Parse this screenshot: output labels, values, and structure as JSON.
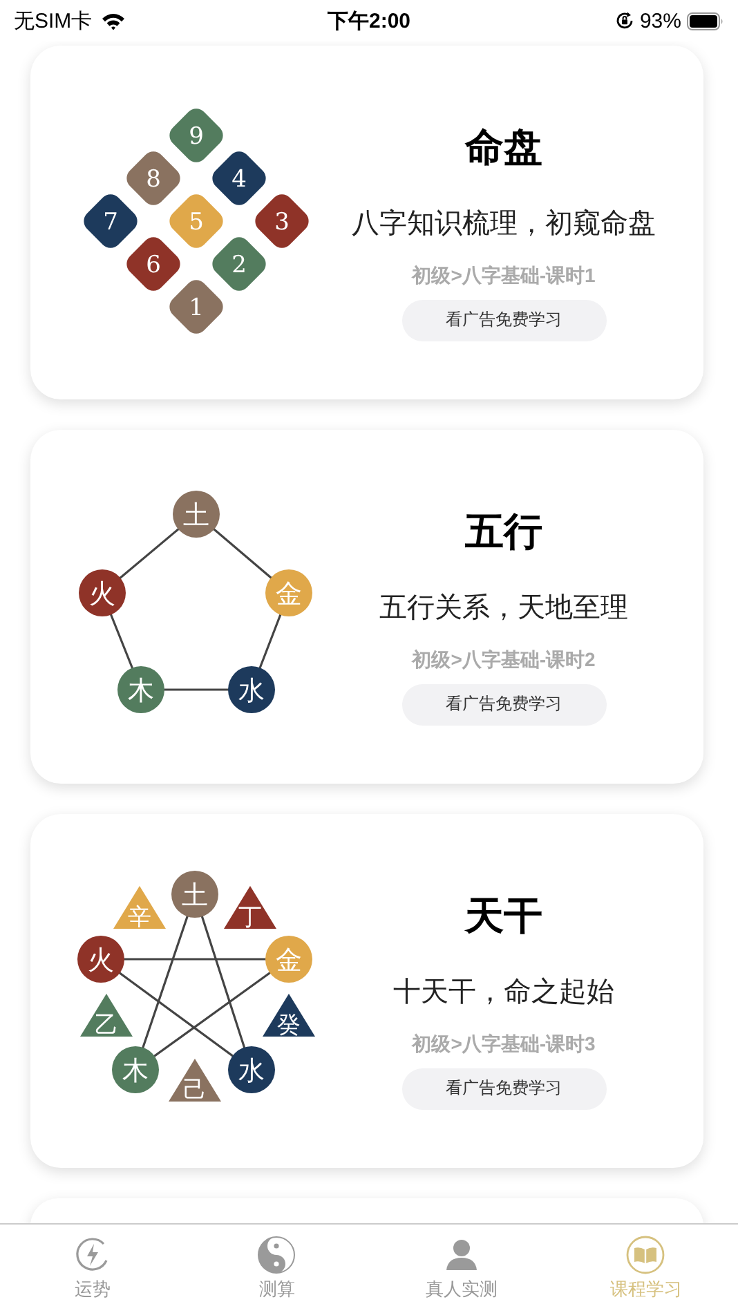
{
  "status_bar": {
    "carrier": "无SIM卡",
    "time": "下午2:00",
    "battery": "93%"
  },
  "lessons": [
    {
      "title": "命盘",
      "subtitle": "八字知识梳理，初窥命盘",
      "path": "初级>八字基础-课时1",
      "button": "看广告免费学习",
      "diagram": {
        "kind": "grid",
        "nodes": [
          {
            "label": "9",
            "kind": "diamond",
            "color": "#537c5e"
          },
          {
            "label": "8",
            "kind": "diamond",
            "color": "#8a7260"
          },
          {
            "label": "4",
            "kind": "diamond",
            "color": "#1d3a5c"
          },
          {
            "label": "7",
            "kind": "diamond",
            "color": "#1d3a5c"
          },
          {
            "label": "5",
            "kind": "diamond",
            "color": "#e0a84a"
          },
          {
            "label": "3",
            "kind": "diamond",
            "color": "#8f3328"
          },
          {
            "label": "6",
            "kind": "diamond",
            "color": "#8f3328"
          },
          {
            "label": "2",
            "kind": "diamond",
            "color": "#537c5e"
          },
          {
            "label": "1",
            "kind": "diamond",
            "color": "#8a7260"
          }
        ]
      }
    },
    {
      "title": "五行",
      "subtitle": "五行关系，天地至理",
      "path": "初级>八字基础-课时2",
      "button": "看广告免费学习",
      "diagram": {
        "kind": "pentagon",
        "nodes": [
          {
            "label": "土",
            "kind": "circle",
            "color": "#8a7260"
          },
          {
            "label": "火",
            "kind": "circle",
            "color": "#8f3328"
          },
          {
            "label": "金",
            "kind": "circle",
            "color": "#e0a84a"
          },
          {
            "label": "木",
            "kind": "circle",
            "color": "#537c5e"
          },
          {
            "label": "水",
            "kind": "circle",
            "color": "#1d3a5c"
          }
        ]
      }
    },
    {
      "title": "天干",
      "subtitle": "十天干，命之起始",
      "path": "初级>八字基础-课时3",
      "button": "看广告免费学习",
      "diagram": {
        "kind": "star",
        "nodes": [
          {
            "label": "辛",
            "kind": "triangle",
            "color": "#e0a84a"
          },
          {
            "label": "土",
            "kind": "circle",
            "color": "#8a7260"
          },
          {
            "label": "丁",
            "kind": "triangle",
            "color": "#8f3328"
          },
          {
            "label": "火",
            "kind": "circle",
            "color": "#8f3328"
          },
          {
            "label": "金",
            "kind": "circle",
            "color": "#e0a84a"
          },
          {
            "label": "乙",
            "kind": "triangle",
            "color": "#537c5e"
          },
          {
            "label": "癸",
            "kind": "triangle",
            "color": "#1d3a5c"
          },
          {
            "label": "木",
            "kind": "circle",
            "color": "#537c5e"
          },
          {
            "label": "己",
            "kind": "triangle",
            "color": "#8a7260"
          },
          {
            "label": "水",
            "kind": "circle",
            "color": "#1d3a5c"
          }
        ]
      }
    }
  ],
  "tab_bar": [
    {
      "label": "运势",
      "selected": false
    },
    {
      "label": "测算",
      "selected": false
    },
    {
      "label": "真人实测",
      "selected": false
    },
    {
      "label": "课程学习",
      "selected": true
    }
  ]
}
